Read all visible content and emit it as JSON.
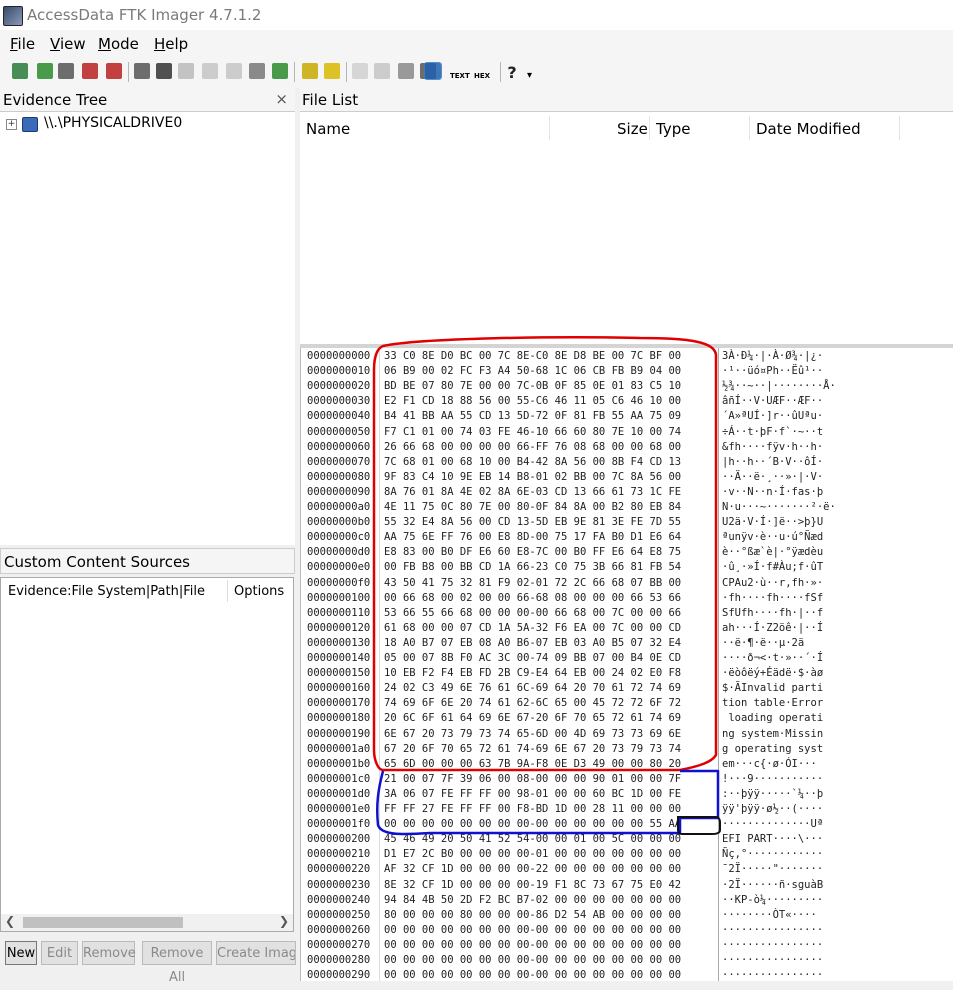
{
  "window": {
    "title": "AccessData FTK Imager 4.7.1.2"
  },
  "menu": {
    "items": [
      {
        "label": "File",
        "ul": "F",
        "rest": "ile"
      },
      {
        "label": "View",
        "ul": "V",
        "rest": "iew"
      },
      {
        "label": "Mode",
        "ul": "M",
        "rest": "ode"
      },
      {
        "label": "Help",
        "ul": "H",
        "rest": "elp"
      }
    ]
  },
  "toolbar": {
    "icons": [
      "add-evidence-icon",
      "add-all-attached-icon",
      "image-mounting-icon",
      "remove-evidence-icon",
      "remove-all-evidence-icon",
      "create-disk-image-icon",
      "export-disk-image-icon",
      "export-logical-image-icon",
      "add-to-custom-content-icon",
      "create-custom-content-image-icon",
      "decrypt-icon",
      "verify-drive-icon",
      "capture-memory-icon",
      "obtain-protected-files-icon",
      "detect-encryption-icon",
      "export-files-icon",
      "export-hash-list-icon",
      "export-directory-listing-icon",
      "view-auto-icon",
      "view-text-icon",
      "view-hex-icon",
      "help-icon",
      "dropdown-arrow-icon"
    ]
  },
  "evidence_tree": {
    "title": "Evidence Tree",
    "close": "×",
    "root": {
      "label": "\\\\.\\PHYSICALDRIVE0",
      "expander": "+"
    }
  },
  "custom_content": {
    "title": "Custom Content Sources",
    "columns": [
      "Evidence:File System|Path|File",
      "Options"
    ],
    "buttons": [
      "New",
      "Edit",
      "Remove",
      "Remove All",
      "Create Image"
    ]
  },
  "file_list": {
    "title": "File List",
    "columns": [
      "Name",
      "Size",
      "Type",
      "Date Modified"
    ]
  },
  "hex": {
    "rows": [
      [
        "0000000000",
        "33 C0 8E D0 BC 00 7C 8E-C0 8E D8 BE 00 7C BF 00",
        "3À·Ð¼·|·À·Ø¾·|¿·"
      ],
      [
        "0000000010",
        "06 B9 00 02 FC F3 A4 50-68 1C 06 CB FB B9 04 00",
        "·¹··üó¤Ph··Ëû¹··"
      ],
      [
        "0000000020",
        "BD BE 07 80 7E 00 00 7C-0B 0F 85 0E 01 83 C5 10",
        "½¾··~··|········Å·"
      ],
      [
        "0000000030",
        "E2 F1 CD 18 88 56 00 55-C6 46 11 05 C6 46 10 00",
        "âñÍ··V·UÆF··ÆF··"
      ],
      [
        "0000000040",
        "B4 41 BB AA 55 CD 13 5D-72 0F 81 FB 55 AA 75 09",
        "´A»ªUÍ·]r··ûUªu·"
      ],
      [
        "0000000050",
        "F7 C1 01 00 74 03 FE 46-10 66 60 80 7E 10 00 74",
        "÷Á··t·þF·f`·~··t"
      ],
      [
        "0000000060",
        "26 66 68 00 00 00 00 66-FF 76 08 68 00 00 68 00",
        "&fh····fÿv·h··h·"
      ],
      [
        "0000000070",
        "7C 68 01 00 68 10 00 B4-42 8A 56 00 8B F4 CD 13",
        "|h··h··´B·V··ôÍ·"
      ],
      [
        "0000000080",
        "9F 83 C4 10 9E EB 14 B8-01 02 BB 00 7C 8A 56 00",
        "··Ä··ë·¸··»·|·V·"
      ],
      [
        "0000000090",
        "8A 76 01 8A 4E 02 8A 6E-03 CD 13 66 61 73 1C FE",
        "·v··N··n·Í·fas·þ"
      ],
      [
        "00000000a0",
        "4E 11 75 0C 80 7E 00 80-0F 84 8A 00 B2 80 EB 84",
        "N·u···~·······²·ë·"
      ],
      [
        "00000000b0",
        "55 32 E4 8A 56 00 CD 13-5D EB 9E 81 3E FE 7D 55",
        "U2ä·V·Í·]ë··>þ}U"
      ],
      [
        "00000000c0",
        "AA 75 6E FF 76 00 E8 8D-00 75 17 FA B0 D1 E6 64",
        "ªunÿv·è··u·ú°Ñæd"
      ],
      [
        "00000000d0",
        "E8 83 00 B0 DF E6 60 E8-7C 00 B0 FF E6 64 E8 75",
        "è··°ßæ`è|·°ÿædèu"
      ],
      [
        "00000000e0",
        "00 FB B8 00 BB CD 1A 66-23 C0 75 3B 66 81 FB 54",
        "·û¸·»Í·f#Àu;f·ûT"
      ],
      [
        "00000000f0",
        "43 50 41 75 32 81 F9 02-01 72 2C 66 68 07 BB 00",
        "CPAu2·ù··r,fh·»·"
      ],
      [
        "0000000100",
        "00 66 68 00 02 00 00 66-68 08 00 00 00 66 53 66",
        "·fh····fh····fSf"
      ],
      [
        "0000000110",
        "53 66 55 66 68 00 00 00-00 66 68 00 7C 00 00 66",
        "SfUfh····fh·|··f"
      ],
      [
        "0000000120",
        "61 68 00 00 07 CD 1A 5A-32 F6 EA 00 7C 00 00 CD",
        "ah···Í·Z2öê·|··Í"
      ],
      [
        "0000000130",
        "18 A0 B7 07 EB 08 A0 B6-07 EB 03 A0 B5 07 32 E4",
        "··ë·¶·ë··µ·2ä"
      ],
      [
        "0000000140",
        "05 00 07 8B F0 AC 3C 00-74 09 BB 07 00 B4 0E CD",
        "····ð¬<·t·»··´·Í"
      ],
      [
        "0000000150",
        "10 EB F2 F4 EB FD 2B C9-E4 64 EB 00 24 02 E0 F8",
        "·ëòôëý+Éädë·$·àø"
      ],
      [
        "0000000160",
        "24 02 C3 49 6E 76 61 6C-69 64 20 70 61 72 74 69",
        "$·ÃInvalid parti"
      ],
      [
        "0000000170",
        "74 69 6F 6E 20 74 61 62-6C 65 00 45 72 72 6F 72",
        "tion table·Error"
      ],
      [
        "0000000180",
        "20 6C 6F 61 64 69 6E 67-20 6F 70 65 72 61 74 69",
        " loading operati"
      ],
      [
        "0000000190",
        "6E 67 20 73 79 73 74 65-6D 00 4D 69 73 73 69 6E",
        "ng system·Missin"
      ],
      [
        "00000001a0",
        "67 20 6F 70 65 72 61 74-69 6E 67 20 73 79 73 74",
        "g operating syst"
      ],
      [
        "00000001b0",
        "65 6D 00 00 00 63 7B 9A-F8 0E D3 49 00 00 80 20",
        "em···c{·ø·ÓI··· "
      ],
      [
        "00000001c0",
        "21 00 07 7F 39 06 00 08-00 00 00 90 01 00 00 7F",
        "!···9···········"
      ],
      [
        "00000001d0",
        "3A 06 07 FE FF FF 00 98-01 00 00 60 BC 1D 00 FE",
        ":··þÿÿ·····`¼··þ"
      ],
      [
        "00000001e0",
        "FF FF 27 FE FF FF 00 F8-BD 1D 00 28 11 00 00 00",
        "ÿÿ'þÿÿ·ø½··(····"
      ],
      [
        "00000001f0",
        "00 00 00 00 00 00 00 00-00 00 00 00 00 00 55 AA",
        "··············Uª"
      ],
      [
        "0000000200",
        "45 46 49 20 50 41 52 54-00 00 01 00 5C 00 00 00",
        "EFI PART····\\···"
      ],
      [
        "0000000210",
        "D1 E7 2C B0 00 00 00 00-01 00 00 00 00 00 00 00",
        "Ñç,°············"
      ],
      [
        "0000000220",
        "AF 32 CF 1D 00 00 00 00-22 00 00 00 00 00 00 00",
        "¯2Ï·····\"·······"
      ],
      [
        "0000000230",
        "8E 32 CF 1D 00 00 00 00-19 F1 8C 73 67 75 E0 42",
        "·2Ï······ñ·sguàB"
      ],
      [
        "0000000240",
        "94 84 4B 50 2D F2 BC B7-02 00 00 00 00 00 00 00",
        "··KP-ò¼·········"
      ],
      [
        "0000000250",
        "80 00 00 00 80 00 00 00-86 D2 54 AB 00 00 00 00",
        "········ÒT«····"
      ],
      [
        "0000000260",
        "00 00 00 00 00 00 00 00-00 00 00 00 00 00 00 00",
        "················"
      ],
      [
        "0000000270",
        "00 00 00 00 00 00 00 00-00 00 00 00 00 00 00 00",
        "················"
      ],
      [
        "0000000280",
        "00 00 00 00 00 00 00 00-00 00 00 00 00 00 00 00",
        "················"
      ],
      [
        "0000000290",
        "00 00 00 00 00 00 00 00-00 00 00 00 00 00 00 00",
        "················"
      ]
    ]
  },
  "colors": {
    "annotation_red": "#e00000",
    "annotation_blue": "#1010d0",
    "annotation_black": "#111111",
    "active_toggle": "#cde1f7"
  }
}
